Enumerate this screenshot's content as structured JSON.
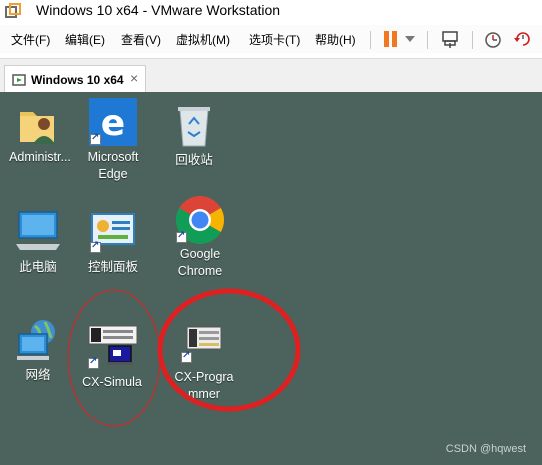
{
  "window": {
    "title": "Windows 10 x64 - VMware Workstation"
  },
  "menu": [
    "文件(F)",
    "编辑(E)",
    "查看(V)",
    "虚拟机(M)",
    "选项卡(T)",
    "帮助(H)"
  ],
  "toolbar_icons": [
    "pause-icon",
    "dropdown-arrow-icon",
    "send-ctrl-alt-del-icon",
    "snapshot-icon",
    "revert-snapshot-icon"
  ],
  "tab": {
    "label": "Windows 10 x64",
    "close": "×"
  },
  "desktop": {
    "icons": [
      {
        "id": "admin",
        "label_lines": [
          "Administr..."
        ],
        "icon": "user-folder-icon"
      },
      {
        "id": "edge",
        "label_lines": [
          "Microsoft",
          "Edge"
        ],
        "icon": "edge-icon"
      },
      {
        "id": "recycle",
        "label_lines": [
          "回收站"
        ],
        "icon": "recycle-bin-icon"
      },
      {
        "id": "thispc",
        "label_lines": [
          "此电脑"
        ],
        "icon": "computer-icon"
      },
      {
        "id": "control",
        "label_lines": [
          "控制面板"
        ],
        "icon": "control-panel-icon"
      },
      {
        "id": "chrome",
        "label_lines": [
          "Google",
          "Chrome"
        ],
        "icon": "chrome-icon"
      },
      {
        "id": "network",
        "label_lines": [
          "网络"
        ],
        "icon": "network-icon"
      },
      {
        "id": "cxsim",
        "label_lines": [
          "CX-Simula"
        ],
        "icon": "cx-simulator-icon"
      },
      {
        "id": "cxprog",
        "label_lines": [
          "CX-Progra",
          "mmer"
        ],
        "icon": "cx-programmer-icon"
      }
    ]
  },
  "watermark": "CSDN @hqwest",
  "colors": {
    "desktop_bg": "#4b635c",
    "annotation_red": "#e02020",
    "pause_orange": "#f07820"
  }
}
